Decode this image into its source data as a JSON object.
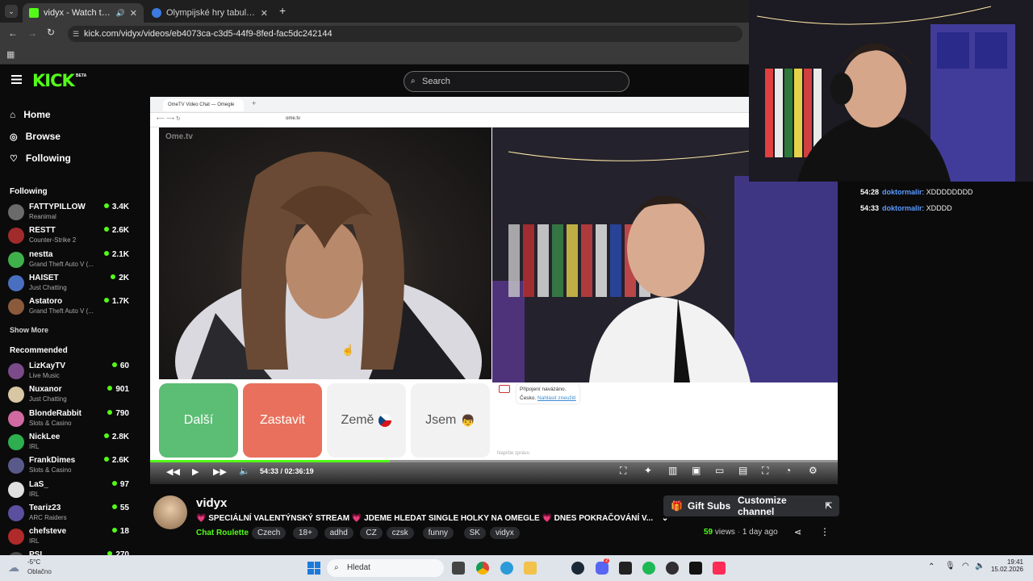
{
  "browser": {
    "tabs": [
      {
        "title": "vidyx - Watch the VOD on Kick",
        "active": true
      },
      {
        "title": "Olympijské hry tabulka - Hokej",
        "active": false
      }
    ],
    "url": "kick.com/vidyx/videos/eb4073ca-c3d5-44f9-8fed-fac5dc242144"
  },
  "kick": {
    "logo": "KICK",
    "logo_badge": "BETA",
    "search_placeholder": "Search",
    "nav": [
      {
        "label": "Home",
        "icon": "home-icon"
      },
      {
        "label": "Browse",
        "icon": "compass-icon"
      },
      {
        "label": "Following",
        "icon": "heart-icon"
      }
    ],
    "following_title": "Following",
    "following": [
      {
        "name": "FATTYPILLOW",
        "game": "Reanimal",
        "viewers": "3.4K",
        "color": "#6b6b6b"
      },
      {
        "name": "RESTT",
        "game": "Counter-Strike 2",
        "viewers": "2.6K",
        "color": "#a12b2b"
      },
      {
        "name": "nestta",
        "game": "Grand Theft Auto V (...",
        "viewers": "2.1K",
        "color": "#3fb04a"
      },
      {
        "name": "HAISET",
        "game": "Just Chatting",
        "viewers": "2K",
        "color": "#4a6fc0"
      },
      {
        "name": "Astatoro",
        "game": "Grand Theft Auto V (...",
        "viewers": "1.7K",
        "color": "#8a5a3a"
      }
    ],
    "show_more": "Show More",
    "recommended_title": "Recommended",
    "recommended": [
      {
        "name": "LizKayTV",
        "game": "Live Music",
        "viewers": "60",
        "color": "#7a4a8a"
      },
      {
        "name": "Nuxanor",
        "game": "Just Chatting",
        "viewers": "901",
        "color": "#d8c7a3"
      },
      {
        "name": "BlondeRabbit",
        "game": "Slots & Casino",
        "viewers": "790",
        "color": "#d16aa0"
      },
      {
        "name": "NickLee",
        "game": "IRL",
        "viewers": "2.8K",
        "color": "#2fae4f"
      },
      {
        "name": "FrankDimes",
        "game": "Slots & Casino",
        "viewers": "2.6K",
        "color": "#5a5a8a"
      },
      {
        "name": "LaS_",
        "game": "IRL",
        "viewers": "97",
        "color": "#e0e0e0"
      },
      {
        "name": "Teariz23",
        "game": "ARC Raiders",
        "viewers": "55",
        "color": "#5b4fa0"
      },
      {
        "name": "chefsteve",
        "game": "IRL",
        "viewers": "18",
        "color": "#b02a2a"
      },
      {
        "name": "PSI_",
        "game": "",
        "viewers": "270",
        "color": "#4a4a4a"
      }
    ]
  },
  "inner_browser": {
    "tab_title": "OmeTV Video Chat — Omegle",
    "url": "ome.tv",
    "ome_logo": "Ome.tv",
    "buttons": [
      {
        "label": "Další",
        "bg": "#5cbd74"
      },
      {
        "label": "Zastavit",
        "bg": "#e8705c"
      },
      {
        "label": "Země",
        "bg": "#f2f2f2"
      },
      {
        "label": "Jsem",
        "bg": "#f2f2f2"
      }
    ],
    "chat_status": "Připojení navázáno.",
    "chat_country": "Česko.",
    "chat_report": "Nahlásit zneužití",
    "chat_placeholder": "Napište zprávu"
  },
  "player": {
    "time_current": "54:33",
    "time_total": "02:36:19",
    "progress": 0.349
  },
  "chat": {
    "messages": [
      {
        "time": "54:28",
        "user": "doktormalir",
        "text": "XDDDDDDDD"
      },
      {
        "time": "54:33",
        "user": "doktormalir",
        "text": "XDDDD"
      }
    ]
  },
  "stream": {
    "streamer": "vidyx",
    "title": "💗 SPECIÁLNÍ VALENTÝNSKÝ STREAM 💗 JDEME HLEDAT SINGLE HOLKY NA OMEGLE 💗 DNES POKRAČOVÁNÍ V...",
    "category": "Chat Roulette",
    "tags": [
      "Czech",
      "18+",
      "adhd",
      "CZ",
      "czsk",
      "funny",
      "SK",
      "vidyx"
    ],
    "views": "59",
    "views_label": "views",
    "age": "1 day ago",
    "gift_label": "Gift Subs",
    "customize_label": "Customize channel"
  },
  "taskbar": {
    "weather_temp": "-5°C",
    "weather_desc": "Oblačno",
    "search_placeholder": "Hledat",
    "time": "19:41",
    "date": "15.02.2026",
    "discord_badge": "2"
  },
  "colors": {
    "kick_green": "#53fc18",
    "username_blue": "#5a9bff"
  }
}
